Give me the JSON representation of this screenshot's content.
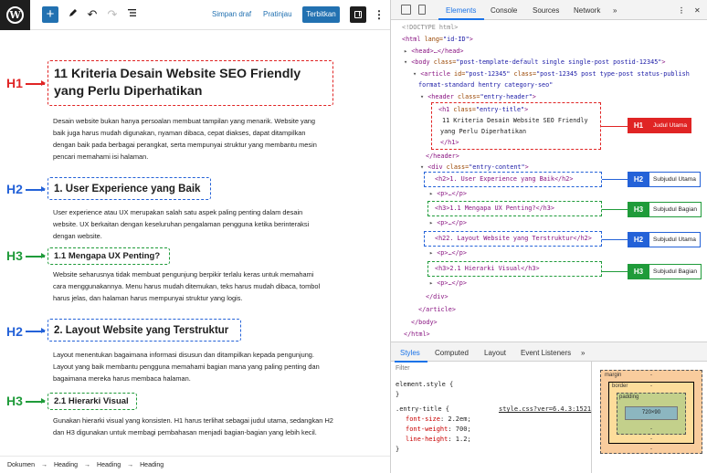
{
  "editor": {
    "toolbar": {
      "save_draft": "Simpan draf",
      "preview": "Pratinjau",
      "publish": "Terbitkan"
    },
    "content": {
      "h1": {
        "tag": "H1",
        "text": "11 Kriteria Desain Website SEO Friendly yang Perlu Diperhatikan"
      },
      "p1": "Desain website bukan hanya persoalan membuat tampilan yang menarik. Website yang baik juga harus mudah digunakan, nyaman dibaca, cepat diakses, dapat ditampilkan dengan baik pada berbagai perangkat, serta mempunyai struktur yang membantu mesin pencari memahami isi halaman.",
      "h2a": {
        "tag": "H2",
        "text": "1. User Experience yang Baik"
      },
      "p2": "User experience atau UX merupakan salah satu aspek paling penting dalam desain website. UX berkaitan dengan keseluruhan pengalaman pengguna ketika berinteraksi dengan website.",
      "h3a": {
        "tag": "H3",
        "text": "1.1 Mengapa UX Penting?"
      },
      "p3": "Website seharusnya tidak membuat pengunjung berpikir terlalu keras untuk memahami cara menggunakannya. Menu harus mudah ditemukan, teks harus mudah dibaca, tombol harus jelas, dan halaman harus mempunyai struktur yang logis.",
      "h2b": {
        "tag": "H2",
        "text": "2. Layout Website yang Terstruktur"
      },
      "p4": "Layout menentukan bagaimana informasi disusun dan ditampilkan kepada pengunjung. Layout yang baik membantu pengguna memahami bagian mana yang paling penting dan bagaimana mereka harus membaca halaman.",
      "h3b": {
        "tag": "H3",
        "text": "2.1 Hierarki Visual"
      },
      "p5": "Gunakan hierarki visual yang konsisten. H1 harus terlihat sebagai judul utama, sedangkan H2 dan H3 digunakan untuk membagi pembahasan menjadi bagian-bagian yang lebih kecil."
    },
    "breadcrumb": [
      "Dokumen",
      "Heading",
      "Heading",
      "Heading"
    ],
    "breadcrumb_sep": "→"
  },
  "devtools": {
    "tabs": [
      "Elements",
      "Console",
      "Sources",
      "Network"
    ],
    "more_tabs": "»",
    "dom": {
      "doctype": "<!DOCTYPE html>",
      "html_open_tag": "<html",
      "html_lang_attr": "lang=",
      "html_lang_val": "\"id-ID\"",
      "head": "<head>…</head>",
      "body_open": "<body",
      "body_class_attr": "class=",
      "body_class_val": "\"post-template-default single single-post postid-12345\"",
      "article_open": "<article",
      "article_id_attr": "id=",
      "article_id_val": "\"post-12345\"",
      "article_class_attr": "class=",
      "article_class_val": "\"post-12345 post type-post status-publish",
      "article_class_val2": "format-standard hentry category-seo\"",
      "header_open": "<header",
      "header_class_attr": "class=",
      "header_class_val": "\"entry-header\"",
      "h1_open": "<h1",
      "h1_class_attr": "class=",
      "h1_class_val": "\"entry-title\"",
      "h1_text_1": "11 Kriteria Desain Website SEO Friendly",
      "h1_text_2": "yang Perlu Diperhatikan",
      "h1_close": "</h1>",
      "header_close": "</header>",
      "div_open": "<div",
      "div_class_attr": "class=",
      "div_class_val": "\"entry-content\"",
      "h2a": "<h2>1. User Experience yang Baik</h2>",
      "p_collapsed": "<p>…</p>",
      "h3a": "<h3>1.1 Mengapa UX Penting?</h3>",
      "h2b": "<h22. Layout Website yang Terstruktur</h2>",
      "h3b": "<h3>2.1 Hierarki Visual</h3>",
      "div_close": "</div>",
      "article_close": "</article>",
      "body_close": "</body>",
      "html_close": "</html>"
    },
    "labels": {
      "h1": {
        "tag": "H1",
        "text": "Judul Utama"
      },
      "h2a": {
        "tag": "H2",
        "text": "Subjudul Utama"
      },
      "h3a": {
        "tag": "H3",
        "text": "Subjudul Bagian"
      },
      "h2b": {
        "tag": "H2",
        "text": "Subjudul Utama"
      },
      "h3b": {
        "tag": "H3",
        "text": "Subjudul Bagian"
      }
    },
    "styles_tabs": [
      "Styles",
      "Computed",
      "Layout",
      "Event Listeners"
    ],
    "filter_placeholder": "Filter",
    "styles": {
      "element_style": "element.style {",
      "close_brace": "}",
      "rule_selector": ".entry-title {",
      "rule_source": "style.css?ver=6.4.3:1521",
      "props": [
        {
          "name": "font-size",
          "value": "2.2em;"
        },
        {
          "name": "font-weight",
          "value": "700;"
        },
        {
          "name": "line-height",
          "value": "1.2;"
        }
      ]
    },
    "box_model": {
      "margin": "margin",
      "border": "border",
      "padding": "padding",
      "content": "720×90",
      "dash": "-"
    }
  },
  "colors": {
    "h1": "#e02424",
    "h2": "#2462d8",
    "h3": "#1f9b3a",
    "wp_blue": "#2271b1",
    "devtools_accent": "#1a73e8"
  },
  "icons": [
    "wordpress-logo-icon",
    "plus-icon",
    "pencil-icon",
    "undo-icon",
    "redo-icon",
    "list-view-icon",
    "settings-panel-icon",
    "kebab-menu-icon",
    "inspect-icon",
    "device-toggle-icon",
    "close-icon"
  ]
}
